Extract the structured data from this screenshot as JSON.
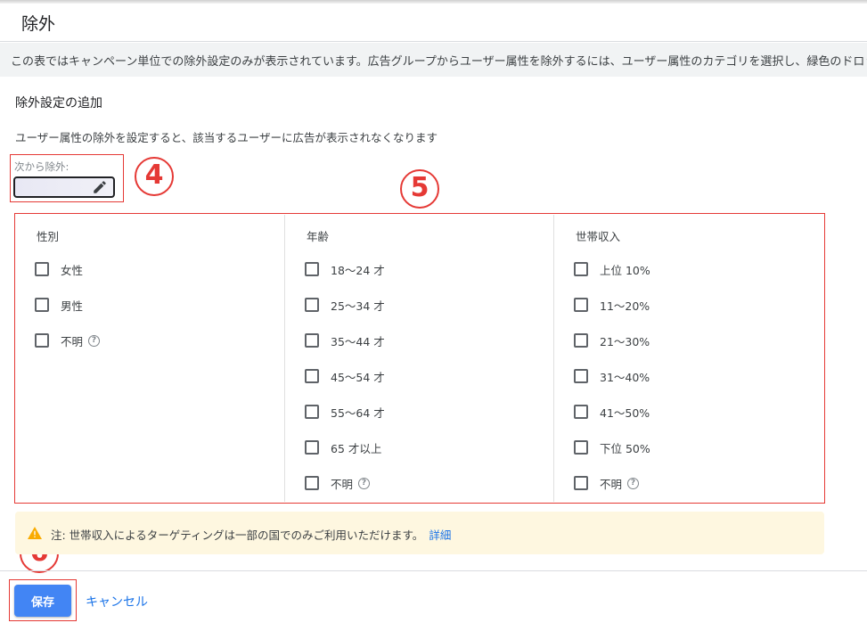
{
  "header": {
    "title": "除外"
  },
  "info_bar": {
    "text": "この表ではキャンペーン単位での除外設定のみが表示されています。広告グループからユーザー属性を除外するには、ユーザー属性のカテゴリを選択し、緑色のドロップダウン"
  },
  "section": {
    "title": "除外設定の追加",
    "description": "ユーザー属性の除外を設定すると、該当するユーザーに広告が表示されなくなります"
  },
  "exclude_from": {
    "label": "次から除外:",
    "value": ""
  },
  "annotations": {
    "step4": "4",
    "step5": "5",
    "step6": "6",
    "color": "#e53935"
  },
  "columns": [
    {
      "header": "性別",
      "options": [
        {
          "label": "女性",
          "help": false
        },
        {
          "label": "男性",
          "help": false
        },
        {
          "label": "不明",
          "help": true
        }
      ]
    },
    {
      "header": "年齢",
      "options": [
        {
          "label": "18～24 才",
          "help": false
        },
        {
          "label": "25～34 才",
          "help": false
        },
        {
          "label": "35～44 才",
          "help": false
        },
        {
          "label": "45～54 才",
          "help": false
        },
        {
          "label": "55～64 才",
          "help": false
        },
        {
          "label": "65 才以上",
          "help": false
        },
        {
          "label": "不明",
          "help": true
        }
      ]
    },
    {
      "header": "世帯収入",
      "options": [
        {
          "label": "上位 10%",
          "help": false
        },
        {
          "label": "11～20%",
          "help": false
        },
        {
          "label": "21～30%",
          "help": false
        },
        {
          "label": "31～40%",
          "help": false
        },
        {
          "label": "41～50%",
          "help": false
        },
        {
          "label": "下位 50%",
          "help": false
        },
        {
          "label": "不明",
          "help": true
        }
      ]
    }
  ],
  "help_glyph": "?",
  "note": {
    "text": "注: 世帯収入によるターゲティングは一部の国でのみご利用いただけます。",
    "link": "詳細"
  },
  "footer": {
    "save_label": "保存",
    "cancel_label": "キャンセル"
  },
  "colors": {
    "primary": "#4285f4",
    "link": "#1a73e8",
    "note_bg": "#fef7e0",
    "warning": "#f9ab00"
  }
}
